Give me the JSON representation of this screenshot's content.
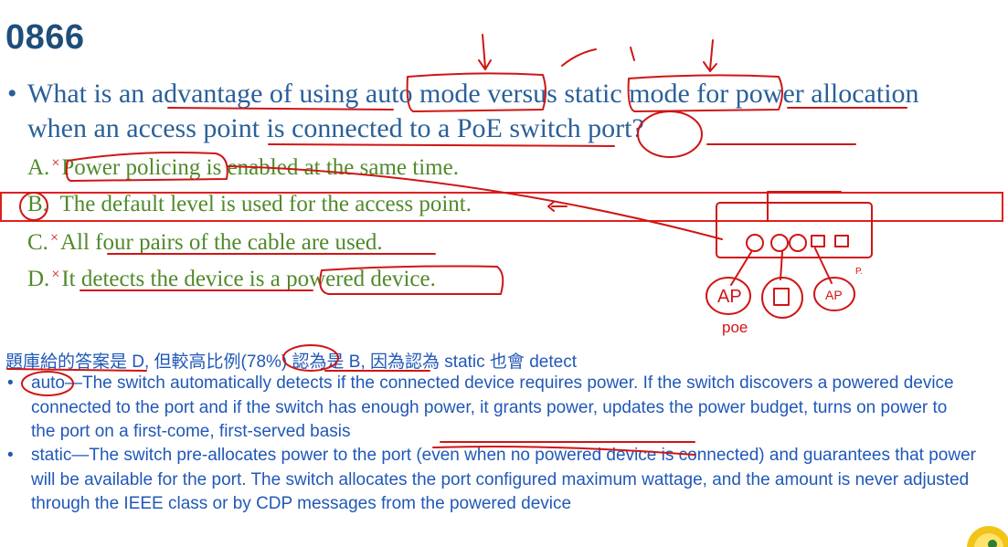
{
  "slide": {
    "title": "0866",
    "question": {
      "bullet": "•",
      "text": "What is an advantage of using auto mode versus static mode for power allocation when an access point is connected to a PoE switch port?"
    },
    "options": [
      {
        "letter": "A.",
        "text": "Power policing is enabled at the same time."
      },
      {
        "letter": "B.",
        "text": "The default level is used for the access point."
      },
      {
        "letter": "C.",
        "text": "All four pairs of the cable are used."
      },
      {
        "letter": "D.",
        "text": "It detects the device is a powered device."
      }
    ],
    "wrong_mark": "×",
    "note": "題庫給的答案是 D, 但較高比例(78%) 認為是 B, 因為認為 static 也會 detect",
    "explanations": [
      {
        "bullet": "•",
        "text": "auto—The switch automatically detects if the connected device requires power. If the switch discovers a powered device connected to the port and if the switch has enough power, it grants power, updates the power budget, turns on power to the port on a first-come, first-served basis"
      },
      {
        "bullet": "•",
        "text": "static—The switch pre-allocates power to the port (even when no powered device is connected) and guarantees that power will be available for the port. The switch allocates the port configured maximum wattage, and the amount is never adjusted through the IEEE class or by CDP messages from the powered device"
      }
    ],
    "sketch_labels": {
      "ap1": "AP",
      "ap2": "AP",
      "poe": "poe",
      "p": "P."
    }
  },
  "colors": {
    "title": "#1f4e79",
    "question": "#2a6099",
    "options": "#4f8a2a",
    "annotation": "#d01515",
    "explanation": "#2058b8"
  }
}
